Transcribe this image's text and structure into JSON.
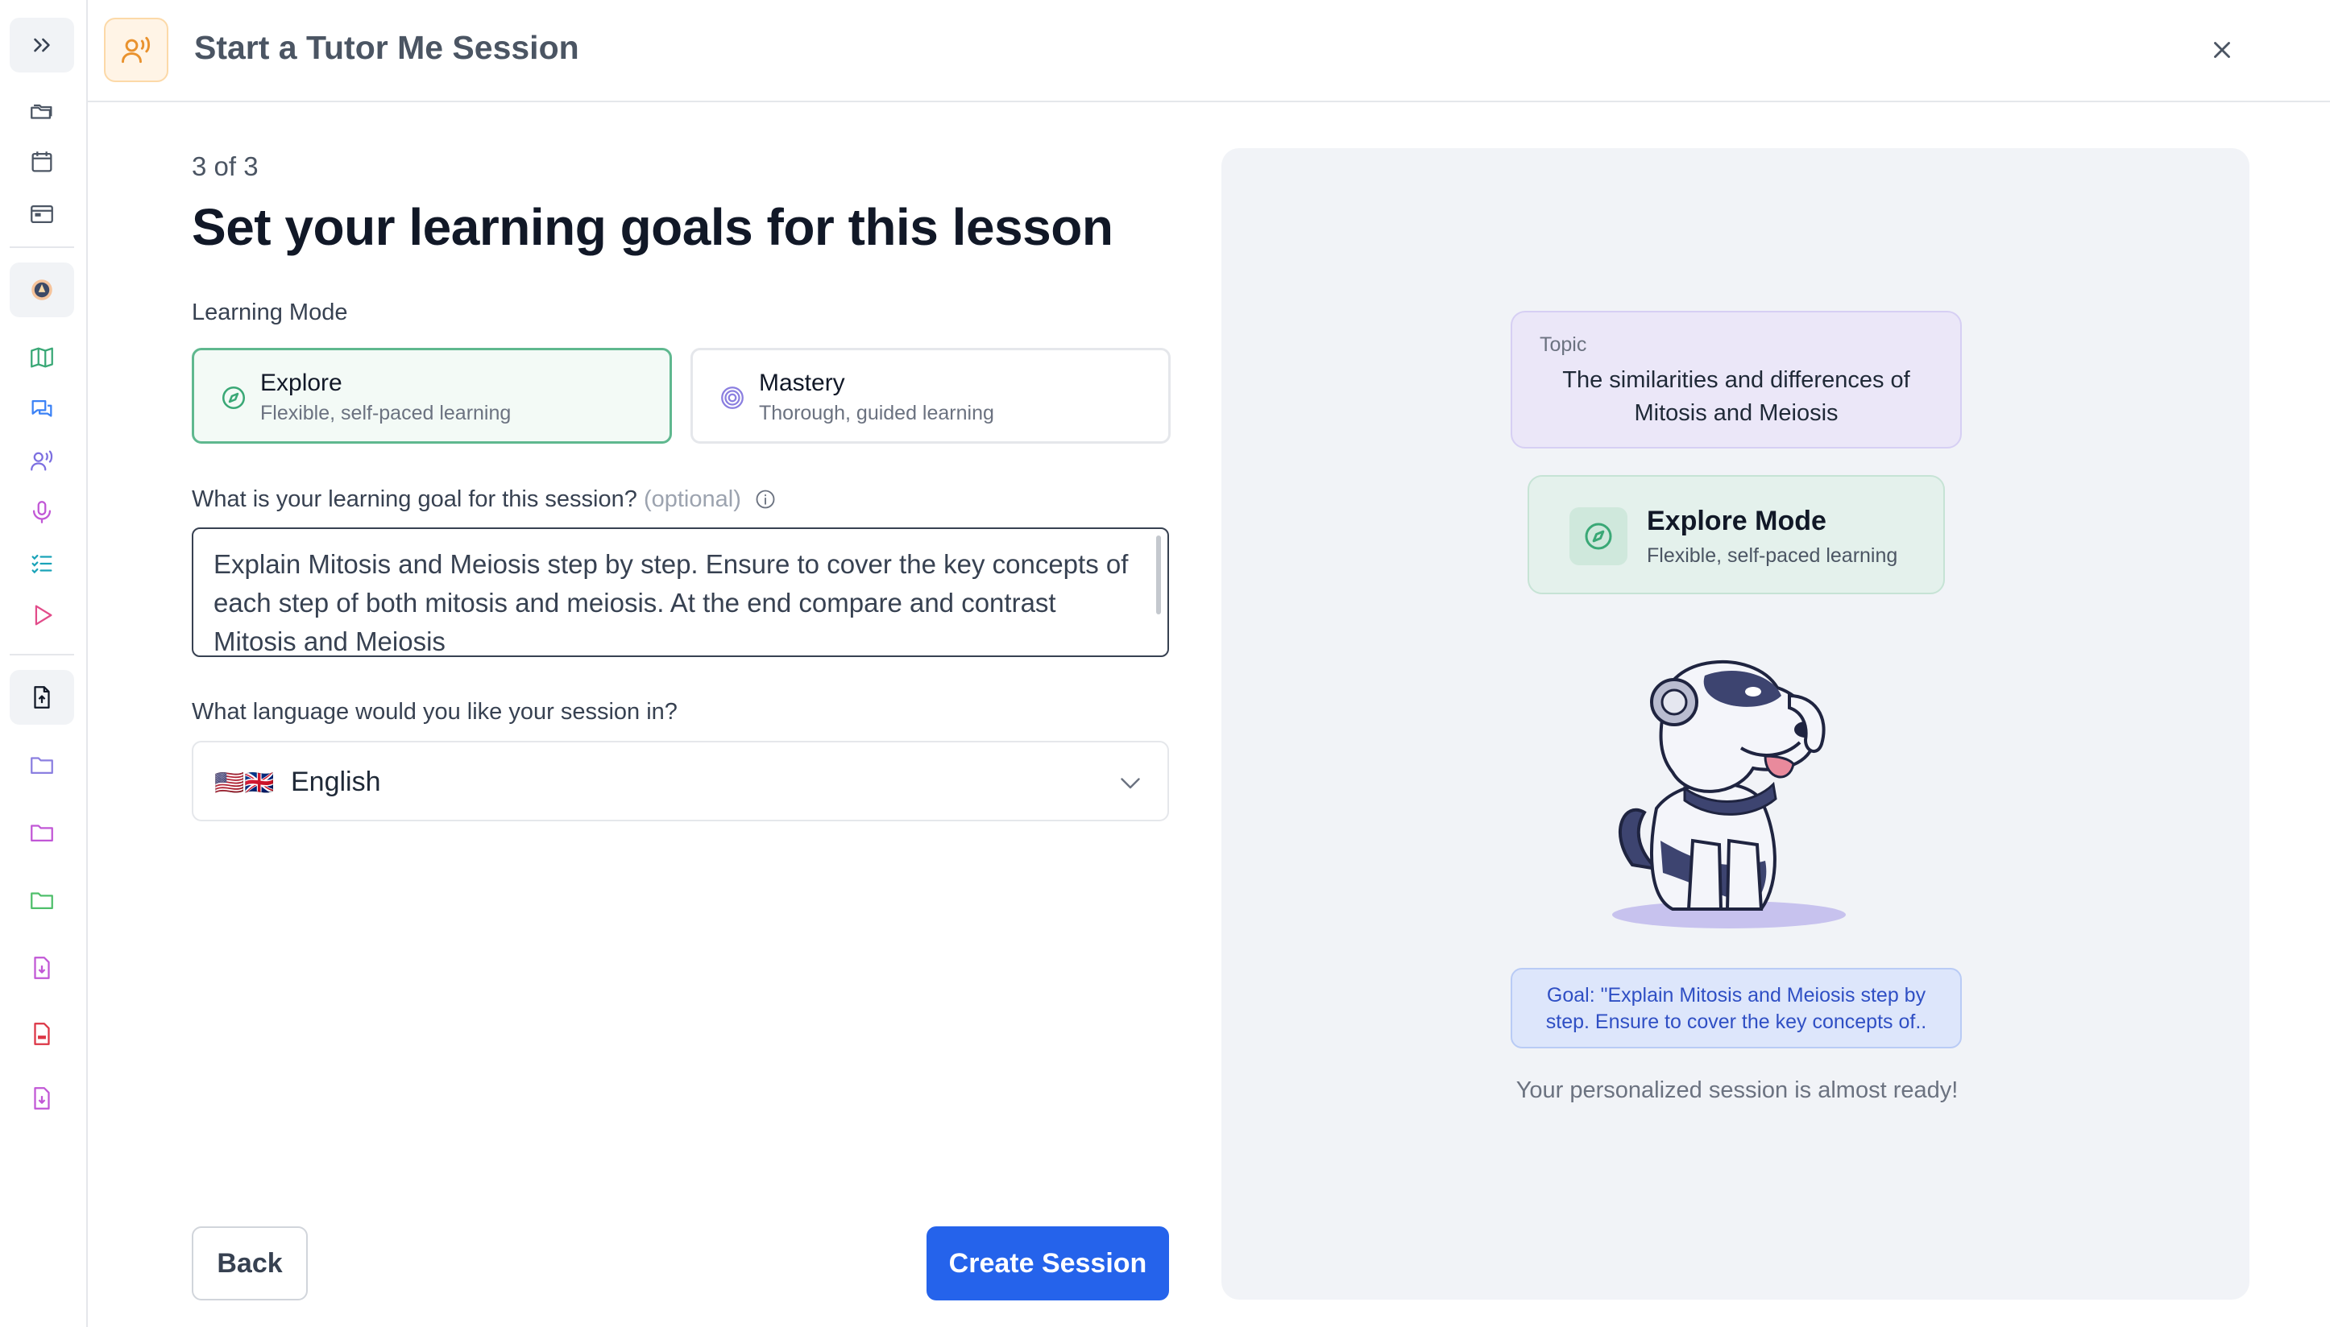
{
  "header": {
    "title": "Start a Tutor Me Session",
    "icon": "tutor-voice-icon",
    "close_icon": "close-icon"
  },
  "sidebar": {
    "items": [
      {
        "name": "expand-icon"
      },
      {
        "name": "folder-stack-icon"
      },
      {
        "name": "calendar-icon"
      },
      {
        "name": "window-icon"
      },
      {
        "name": "avatar-icon"
      },
      {
        "name": "map-icon"
      },
      {
        "name": "chat-bubbles-icon"
      },
      {
        "name": "tutor-voice-icon"
      },
      {
        "name": "microphone-icon"
      },
      {
        "name": "checklist-icon"
      },
      {
        "name": "play-icon"
      },
      {
        "name": "file-upload-icon"
      },
      {
        "name": "folder-icon"
      },
      {
        "name": "folder-icon"
      },
      {
        "name": "folder-icon"
      },
      {
        "name": "file-icon"
      },
      {
        "name": "pdf-file-icon"
      },
      {
        "name": "file-icon"
      }
    ]
  },
  "form": {
    "step": "3 of 3",
    "heading": "Set your learning goals for this lesson",
    "learning_mode_label": "Learning Mode",
    "modes": [
      {
        "title": "Explore",
        "subtitle": "Flexible, self-paced learning",
        "selected": true
      },
      {
        "title": "Mastery",
        "subtitle": "Thorough, guided learning",
        "selected": false
      }
    ],
    "goal_label": "What is your learning goal for this session?",
    "goal_optional": "(optional)",
    "goal_value": "Explain Mitosis and Meiosis step by step. Ensure to cover the key concepts of each step of both mitosis and meiosis. At the end compare and contrast Mitosis and Meiosis",
    "language_label": "What language would you like your session in?",
    "language_flags": "🇺🇸🇬🇧",
    "language_value": "English",
    "back_label": "Back",
    "create_label": "Create Session"
  },
  "preview": {
    "topic_label": "Topic",
    "topic_text": "The similarities and differences of Mitosis and Meiosis",
    "mode_title": "Explore Mode",
    "mode_subtitle": "Flexible, self-paced learning",
    "goal_text": "Goal: \"Explain Mitosis and Meiosis step by step. Ensure to cover the key concepts of..",
    "ready_text": "Your personalized session is almost ready!"
  },
  "colors": {
    "accent": "#2563eb",
    "explore_green": "#5fb88f",
    "mastery_purple": "#8b7fe0",
    "header_icon_orange": "#e9922e"
  }
}
